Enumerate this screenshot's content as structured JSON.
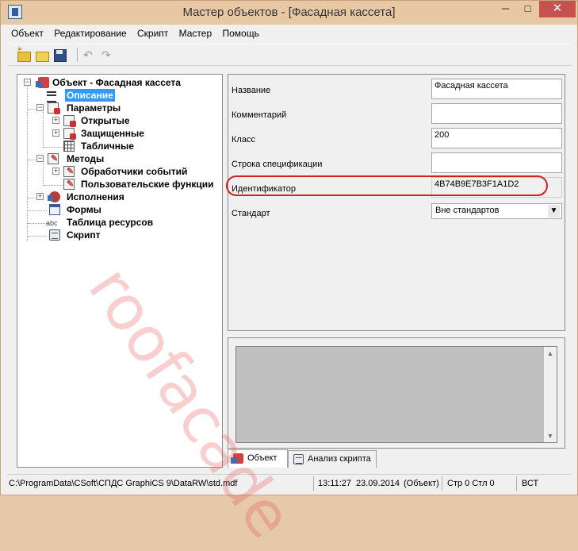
{
  "window": {
    "title": "Мастер объектов - [Фасадная кассета]",
    "controls": {
      "minimize": "─",
      "maximize": "□",
      "close": "✕"
    }
  },
  "menu": [
    "Объект",
    "Редактирование",
    "Скрипт",
    "Мастер",
    "Помощь"
  ],
  "toolbar": {
    "icons": [
      "folder-new-icon",
      "folder-open-icon",
      "save-icon",
      "undo-icon",
      "redo-icon"
    ],
    "undo_glyph": "↶",
    "redo_glyph": "↷"
  },
  "tree": {
    "root": "Объект - Фасадная кассета",
    "items": [
      {
        "label": "Описание",
        "selected": true
      },
      {
        "label": "Параметры"
      },
      {
        "label": "Открытые"
      },
      {
        "label": "Защищенные"
      },
      {
        "label": "Табличные"
      },
      {
        "label": "Методы"
      },
      {
        "label": "Обработчики событий"
      },
      {
        "label": "Пользовательские функции"
      },
      {
        "label": "Исполнения"
      },
      {
        "label": "Формы"
      },
      {
        "label": "Таблица ресурсов",
        "icon_text": "abc"
      },
      {
        "label": "Скрипт"
      }
    ]
  },
  "properties": {
    "name_label": "Название",
    "name_value": "Фасадная кассета",
    "comment_label": "Комментарий",
    "comment_value": "",
    "class_label": "Класс",
    "class_value": "200",
    "spec_label": "Строка спецификации",
    "spec_value": "",
    "id_label": "Идентификатор",
    "id_value": "4B74B9E7B3F1A1D2",
    "standard_label": "Стандарт",
    "standard_value": "Вне стандартов"
  },
  "watermark": "roofacade",
  "tabs": [
    {
      "label": "Объект",
      "active": true
    },
    {
      "label": "Анализ скрипта",
      "active": false
    }
  ],
  "status": {
    "path": "C:\\ProgramData\\CSoft\\СПДС GraphiCS 9\\DataRW\\std.mdf",
    "time": "13:11:27",
    "date": "23.09.2014",
    "mode": "(Объект)",
    "position": "Стр 0 Стл 0",
    "insert": "ВСТ"
  },
  "colors": {
    "selection": "#3399ff",
    "highlight_oval": "#d02020",
    "close_button": "#c75050"
  }
}
